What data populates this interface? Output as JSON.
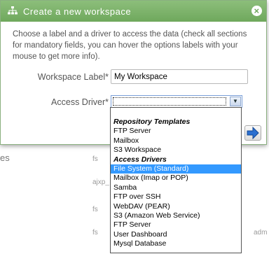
{
  "background": {
    "side_text": "es",
    "cells": [
      "fs",
      "ajxp_",
      "fs",
      "fs",
      "adm"
    ]
  },
  "dialog": {
    "title": "Create a new workspace",
    "close_label": "×",
    "description": "Choose a label and a driver to access the data (check all sections for mandatory fields, you can hover the options labels with your mouse to get more info).",
    "workspace_label": {
      "label": "Workspace Label*",
      "value": "My Workspace"
    },
    "access_driver": {
      "label": "Access Driver*",
      "value": ""
    }
  },
  "dropdown": {
    "groups": [
      {
        "label": "Repository Templates",
        "options": [
          "FTP Server",
          "Mailbox",
          "S3 Workspace"
        ]
      },
      {
        "label": "Access Drivers",
        "options": [
          "File System (Standard)",
          "Mailbox (Imap or POP)",
          "Samba",
          "FTP over SSH",
          "WebDAV (PEAR)",
          "S3 (Amazon Web Service)",
          "FTP Server",
          "User Dashboard",
          "Mysql Database"
        ]
      }
    ],
    "highlighted": "File System (Standard)"
  },
  "colors": {
    "titlebar": "#7db56a",
    "selected": "#3399ff",
    "arrow": "#1a5fb4"
  }
}
